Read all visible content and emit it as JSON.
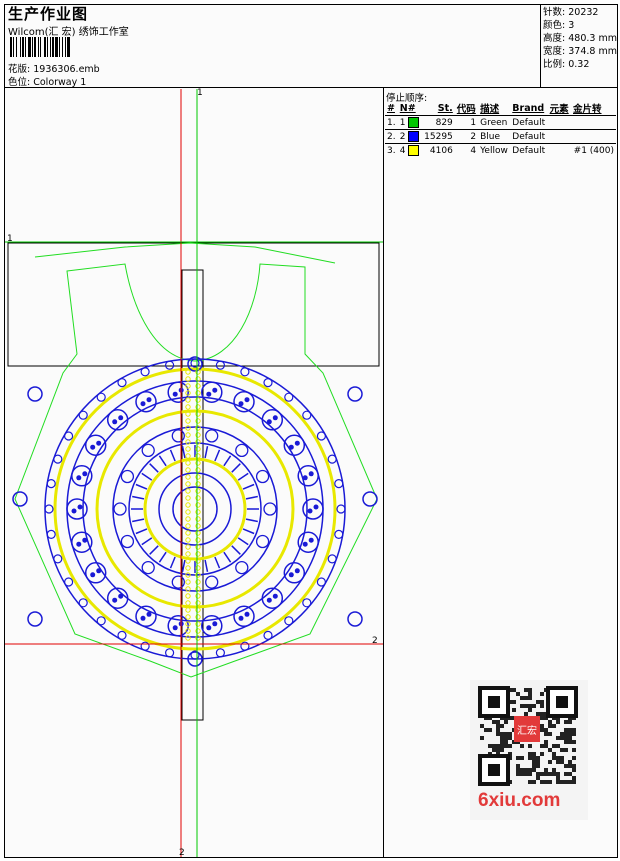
{
  "header": {
    "title": "生产作业图",
    "studio": "Wilcom(汇 宏) 绣饰工作室",
    "design_label": "花版:",
    "design_value": "1936306.emb",
    "colorway_label": "色位:",
    "colorway_value": "Colorway 1"
  },
  "stats": {
    "stitches_label": "针数:",
    "stitches_value": "20232",
    "colors_label": "颜色:",
    "colors_value": "3",
    "height_label": "高度:",
    "height_value": "480.3 mm",
    "width_label": "宽度:",
    "width_value": "374.8 mm",
    "scale_label": "比例:",
    "scale_value": "0.32"
  },
  "stop_sequence": {
    "label": "停止顺序:",
    "columns": [
      "#",
      "N#",
      "St.",
      "代码",
      "描述",
      "Brand",
      "元素",
      "金片转"
    ],
    "rows": [
      {
        "idx": "1.",
        "n": "1",
        "color": "#00c800",
        "st": "829",
        "code": "1",
        "desc": "Green",
        "brand": "Default",
        "elements": "",
        "sequin": ""
      },
      {
        "idx": "2.",
        "n": "2",
        "color": "#0000ff",
        "st": "15295",
        "code": "2",
        "desc": "Blue",
        "brand": "Default",
        "elements": "",
        "sequin": ""
      },
      {
        "idx": "3.",
        "n": "4",
        "color": "#ffff00",
        "st": "4106",
        "code": "4",
        "desc": "Yellow",
        "brand": "Default",
        "elements": "",
        "sequin": "#1 (400)"
      }
    ]
  },
  "guides": {
    "top": "1",
    "left": "1",
    "right": "2",
    "bottom": "2"
  },
  "watermark": {
    "text": "6xiu.com",
    "stamp": "汇宏"
  },
  "colors": {
    "guide_red": "#e00000",
    "guide_green": "#00c800",
    "pattern_blue": "#1a1ad6",
    "pattern_yellow": "#e8e800",
    "outline_green": "#22dd22"
  }
}
